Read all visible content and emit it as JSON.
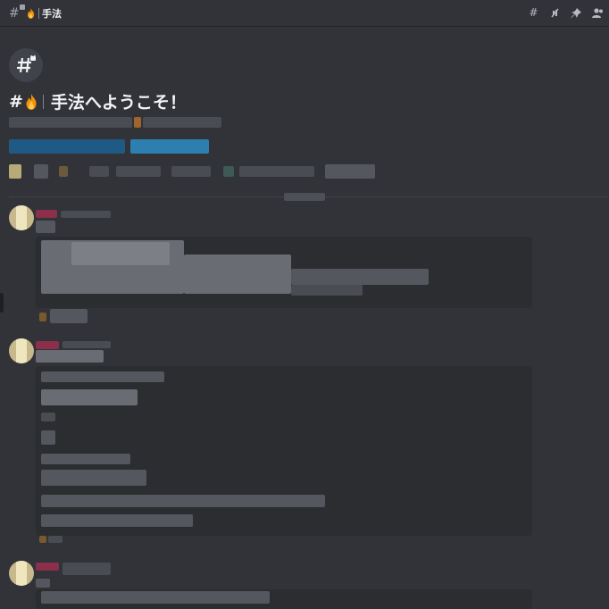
{
  "topbar": {
    "channel_title": "手法",
    "icons": [
      "threads-icon",
      "mute-icon",
      "pin-icon",
      "members-icon"
    ]
  },
  "welcome": {
    "prefix": "#",
    "heading": "手法へようこそ！"
  },
  "colors": {
    "background": "#313338",
    "embed": "#2b2d31",
    "link": "#1e5a84",
    "username_accent": "#8b2f4a"
  }
}
